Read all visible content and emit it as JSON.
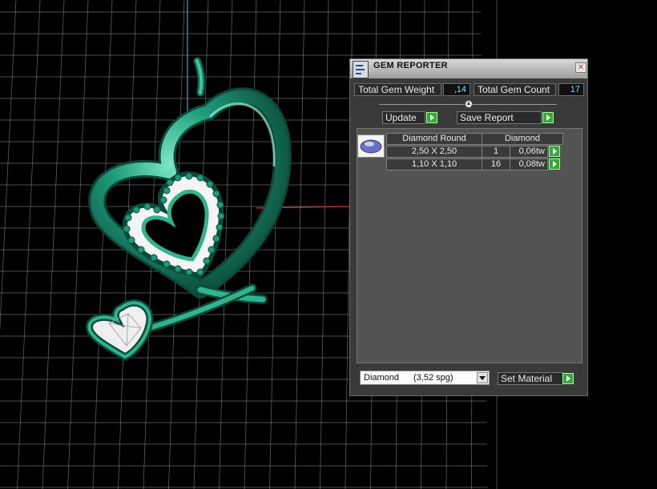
{
  "panel": {
    "title": "GEM REPORTER",
    "close_glyph": "✕",
    "total_weight_label": "Total Gem Weight",
    "total_weight_value": ",14",
    "total_count_label": "Total Gem Count",
    "total_count_value": "17",
    "update_label": "Update",
    "save_report_label": "Save Report",
    "table": {
      "header": [
        "Diamond Round",
        "Diamond"
      ],
      "rows": [
        {
          "size": "2,50 X 2,50",
          "qty": "1",
          "weight": "0,06tw"
        },
        {
          "size": "1,10 X 1,10",
          "qty": "16",
          "weight": "0,08tw"
        }
      ]
    },
    "material_name": "Diamond",
    "material_density": "(3,52 spg)",
    "set_material_label": "Set Material"
  },
  "colors": {
    "metal": "#1d9a78",
    "gem": "#f2f2f2",
    "grid": "#8a8a8a",
    "panel_bg": "#3a3a3a",
    "accent_value": "#6fe0ff",
    "button_green": "#3aa53a"
  },
  "icons": {
    "app": "gem-reporter-icon",
    "close": "close-icon",
    "collapse": "chevron-up-icon",
    "go": "play-arrow-icon",
    "dropdown": "chevron-down-icon",
    "gem_thumb": "round-diamond-icon"
  }
}
